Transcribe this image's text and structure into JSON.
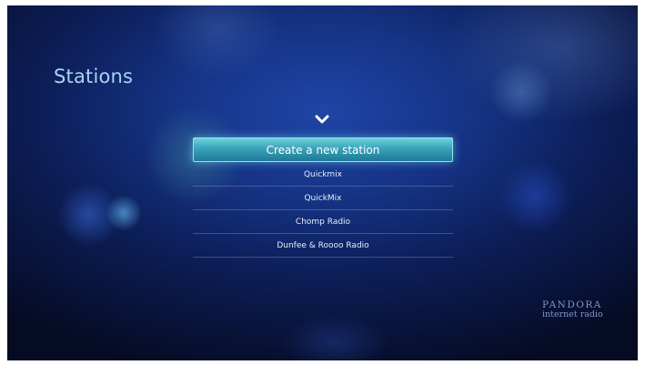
{
  "header": {
    "title": "Stations"
  },
  "navigation": {
    "scroll_up_icon": "chevron-up-icon"
  },
  "station_list": {
    "create_label": "Create a new station",
    "items": [
      {
        "label": "Quickmix"
      },
      {
        "label": "QuickMix"
      },
      {
        "label": "Chomp Radio"
      },
      {
        "label": "Dunfee & Roooo Radio"
      }
    ]
  },
  "branding": {
    "logo_word": "PANDORA",
    "logo_subtitle": "internet radio"
  },
  "colors": {
    "accent": "#3aa2b8",
    "title": "#a9d3f2",
    "background": "#0d1f5a"
  }
}
